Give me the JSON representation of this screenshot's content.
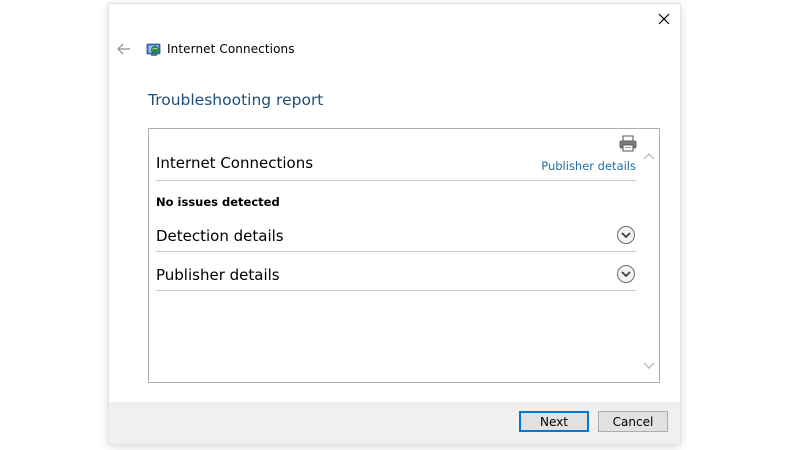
{
  "window": {
    "title": "Internet Connections",
    "icons": {
      "back": "back-arrow-icon",
      "close": "close-icon",
      "app": "network-troubleshooter-icon"
    }
  },
  "page": {
    "heading": "Troubleshooting report"
  },
  "report": {
    "title": "Internet Connections",
    "publisher_link": "Publisher details",
    "status": "No issues detected",
    "sections": [
      {
        "label": "Detection details",
        "icon": "chevron-down-circle-icon"
      },
      {
        "label": "Publisher details",
        "icon": "chevron-down-circle-icon"
      }
    ],
    "print_icon": "printer-icon"
  },
  "footer": {
    "next_label": "Next",
    "cancel_label": "Cancel"
  },
  "colors": {
    "heading": "#1e4e79",
    "link": "#1b6fa8",
    "footer_bg": "#f0f0f0",
    "default_button_border": "#0078d7"
  }
}
